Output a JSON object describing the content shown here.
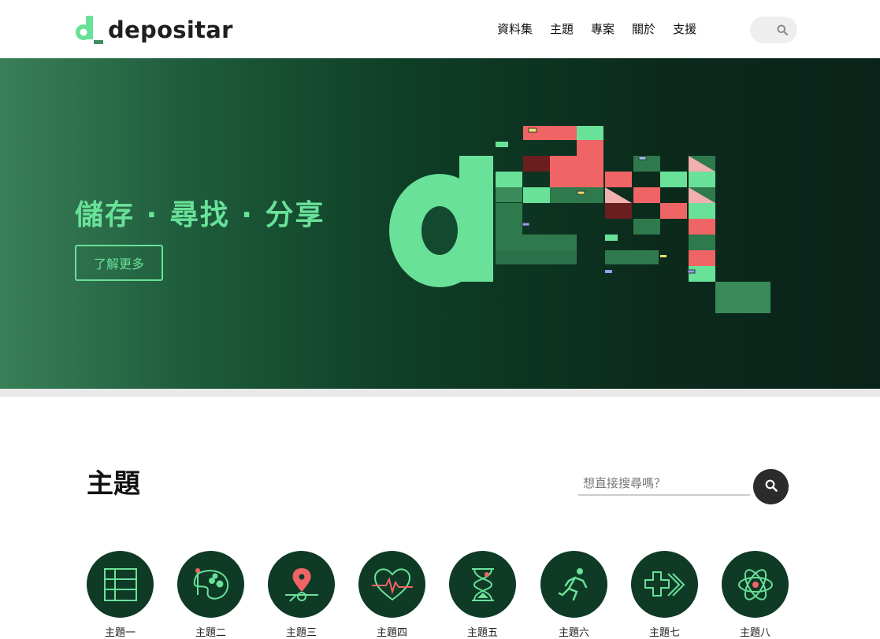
{
  "header": {
    "logo_text": "depositar",
    "nav": [
      "資料集",
      "主題",
      "專案",
      "關於",
      "支援"
    ]
  },
  "hero": {
    "slogan": "儲存 · 尋找 · 分享",
    "learn_more": "了解更多"
  },
  "topics": {
    "title": "主題",
    "search_placeholder": "想直接搜尋嗎？",
    "items": [
      {
        "icon": "table-icon",
        "label": "主題一"
      },
      {
        "icon": "palette-icon",
        "label": "主題二"
      },
      {
        "icon": "map-pin-icon",
        "label": "主題三"
      },
      {
        "icon": "heartbeat-icon",
        "label": "主題四"
      },
      {
        "icon": "hourglass-icon",
        "label": "主題五"
      },
      {
        "icon": "running-icon",
        "label": "主題六"
      },
      {
        "icon": "plus-arrow-icon",
        "label": "主題七"
      },
      {
        "icon": "atom-icon",
        "label": "主題八"
      }
    ]
  },
  "colors": {
    "accent": "#69e199",
    "hero_dark": "#0b2a1c",
    "coral": "#ef6464",
    "icon_bg": "#0f3a26"
  }
}
